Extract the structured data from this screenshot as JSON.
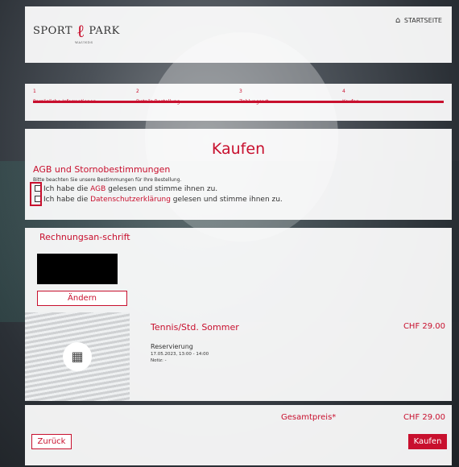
{
  "header": {
    "logo_left": "SPORT",
    "logo_right": "PARK",
    "logo_sub": "WAUNDS",
    "home_label": "STARTSEITE"
  },
  "steps": [
    {
      "num": "1",
      "label": "Persönliche Informationen"
    },
    {
      "num": "2",
      "label": "Details Bestellung"
    },
    {
      "num": "3",
      "label": "Zahlungsart"
    },
    {
      "num": "4",
      "label": "Kaufen"
    }
  ],
  "main": {
    "title": "Kaufen",
    "agb_heading": "AGB und Stornobestimmungen",
    "agb_hint": "Bitte beachten Sie unsere Bestimmungen für Ihre Bestellung.",
    "check1_prefix": "Ich habe die ",
    "check1_link": "AGB",
    "check1_suffix": " gelesen und stimme ihnen zu.",
    "check2_prefix": "Ich habe die ",
    "check2_link": "Datenschutzerklärung",
    "check2_suffix": " gelesen und stimme ihnen zu."
  },
  "address": {
    "label": "Rechnungsan-schrift",
    "change_button": "Ändern"
  },
  "product": {
    "title": "Tennis/Std. Sommer",
    "subtitle": "Reservierung",
    "date": "17.05.2023, 13:00 - 14:00",
    "note": "Notiz: -",
    "price": "CHF 29.00"
  },
  "total": {
    "label": "Gesamtpreis*",
    "value": "CHF 29.00",
    "back_button": "Zurück",
    "buy_button": "Kaufen"
  },
  "colors": {
    "accent": "#c8102e"
  }
}
